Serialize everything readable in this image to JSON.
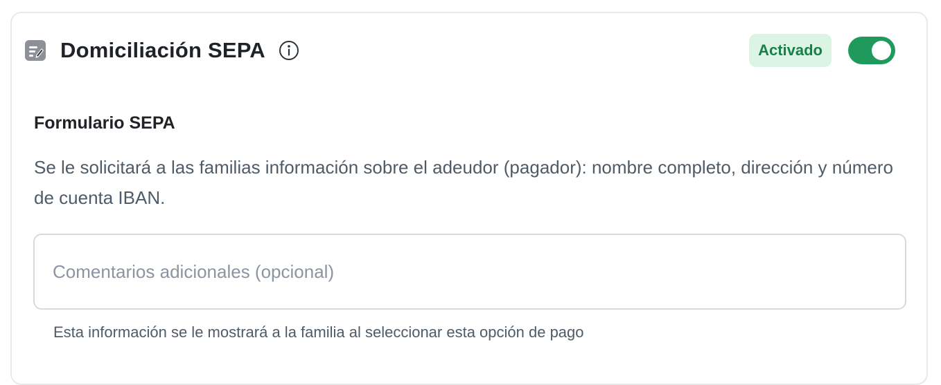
{
  "header": {
    "title": "Domiciliación SEPA",
    "method_icon": "edit-document-icon",
    "info_icon": "info-icon",
    "status_badge": "Activado",
    "toggle_on": true
  },
  "form": {
    "section_title": "Formulario SEPA",
    "description": "Se le solicitará a las familias información sobre el adeudor (pagador): nombre completo, dirección y número de cuenta IBAN.",
    "comments_placeholder": "Comentarios adicionales (opcional)",
    "comments_value": "",
    "helper_text": "Esta información se le mostrará a la familia al seleccionar esta opción de pago"
  },
  "colors": {
    "accent": "#1f9a5c",
    "badge_bg": "#dcf4e4",
    "badge_text": "#17804a",
    "text_primary": "#1f2328",
    "text_secondary": "#4f5b67"
  }
}
